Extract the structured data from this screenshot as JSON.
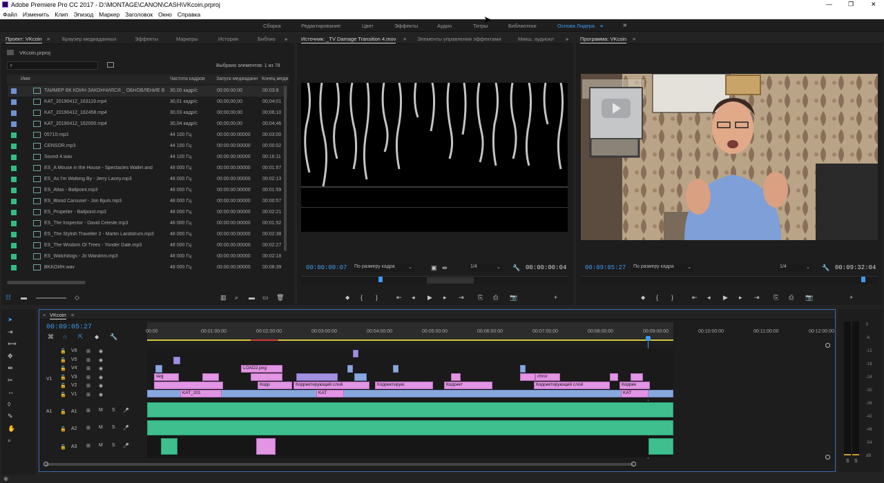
{
  "window": {
    "title": "Adobe Premiere Pro CC 2017 - D:\\MONTAGE\\CANON\\CASH\\VKcoin.prproj",
    "controls": [
      "—",
      "❐",
      "✕"
    ]
  },
  "menu": [
    "Файл",
    "Изменить",
    "Клип",
    "Эпизод",
    "Маркер",
    "Заголовок",
    "Окно",
    "Справка"
  ],
  "workspaces": [
    "Сборка",
    "Редактирование",
    "Цвет",
    "Эффекты",
    "Аудио",
    "Титры",
    "Библиотеки",
    "Основа Лидера"
  ],
  "workspace_active": "Основа Лидера",
  "workspace_more": "»",
  "project": {
    "tabs": [
      "Проект: VKcoin",
      "Браузер медиаданных",
      "Эффекты",
      "Маркеры",
      "История",
      "Библио"
    ],
    "file": "VKcoin.prproj",
    "selection": "Выбрано элементов: 1 из 78",
    "headers": [
      "Имя",
      "Частота кадров",
      "Запуск медиаданн",
      "Конец меди"
    ],
    "rows": [
      {
        "name": "ТАЙМЕР ВК КОИН ЗАКОНЧИЛСЯ _ ОБНОВЛЕНИЕ В",
        "fps": "30,00 кадр/с",
        "start": "00:00:00:00",
        "end": "00:03:8",
        "color": "#6d93d4",
        "type": "video"
      },
      {
        "name": "KAT_20190412_163119.mp4",
        "fps": "30,01 кадр/с",
        "start": "00;00;00;00",
        "end": "00;04;01",
        "color": "#6d93d4",
        "type": "video"
      },
      {
        "name": "KAT_20190412_162458.mp4",
        "fps": "30,03 кадр/с",
        "start": "00;00;00;00",
        "end": "00;06;10",
        "color": "#6d93d4",
        "type": "video"
      },
      {
        "name": "KAT_20190412_162000.mp4",
        "fps": "30,04 кадр/с",
        "start": "00;00;00;00",
        "end": "00;04;46",
        "color": "#6d93d4",
        "type": "video"
      },
      {
        "name": "05710.mp3",
        "fps": "44 100 Гц",
        "start": "00:00:00:00000",
        "end": "00:03:00",
        "color": "#2fbf83",
        "type": "audio"
      },
      {
        "name": "CENSOR.mp3",
        "fps": "44 100 Гц",
        "start": "00:00:00:00000",
        "end": "00:00:02",
        "color": "#2fbf83",
        "type": "audio"
      },
      {
        "name": "Sound 4.wav",
        "fps": "44 100 Гц",
        "start": "00:00:00:00000",
        "end": "00:16:11",
        "color": "#2fbf83",
        "type": "audio"
      },
      {
        "name": "ES_A Mouse in the House - Spectacles Wallet and",
        "fps": "48 000 Гц",
        "start": "00:00:00:00000",
        "end": "00:01:57",
        "color": "#2fbf83",
        "type": "audio"
      },
      {
        "name": "ES_As I'm Walking By - Jerry Lacey.mp3",
        "fps": "48 000 Гц",
        "start": "00:00:00:00000",
        "end": "00:02:13",
        "color": "#2fbf83",
        "type": "audio"
      },
      {
        "name": "ES_Atlas - Ballpoint.mp3",
        "fps": "48 000 Гц",
        "start": "00:00:00:00000",
        "end": "00:01:59",
        "color": "#2fbf83",
        "type": "audio"
      },
      {
        "name": "ES_Blood Carousel - Jon Bjurk.mp3",
        "fps": "48 000 Гц",
        "start": "00:00:00:00000",
        "end": "00:00:57",
        "color": "#2fbf83",
        "type": "audio"
      },
      {
        "name": "ES_Propeller - Ballpoint.mp3",
        "fps": "48 000 Гц",
        "start": "00:00:00:00000",
        "end": "00:02:21",
        "color": "#2fbf83",
        "type": "audio"
      },
      {
        "name": "ES_The Inspector - David Celeste.mp3",
        "fps": "48 000 Гц",
        "start": "00:00:00:00000",
        "end": "00:01:52",
        "color": "#2fbf83",
        "type": "audio"
      },
      {
        "name": "ES_The Stylish Traveller 2 - Martin Landstrum.mp3",
        "fps": "48 000 Гц",
        "start": "00:00:00:00000",
        "end": "00:02:38",
        "color": "#2fbf83",
        "type": "audio"
      },
      {
        "name": "ES_The Wisdom Of Trees - Yonder Dale.mp3",
        "fps": "48 000 Гц",
        "start": "00:00:00:00000",
        "end": "00:02:27",
        "color": "#2fbf83",
        "type": "audio"
      },
      {
        "name": "ES_Watchdogs - Jo Wandrini.mp3",
        "fps": "48 000 Гц",
        "start": "00:00:00:00000",
        "end": "00:02:18",
        "color": "#2fbf83",
        "type": "audio"
      },
      {
        "name": "BKKOИH.wav",
        "fps": "48 000 Гц",
        "start": "00:00:00:00000",
        "end": "00:08:39",
        "color": "#2fbf83",
        "type": "audio"
      }
    ]
  },
  "source": {
    "tabs": [
      "Источник: _TV Damage Transition 4.mov",
      "Элементы управления эффектами",
      "Микш. аудиокл"
    ],
    "timecode": "00:00:00:07",
    "fit": "По размеру кадра",
    "quality": "1/4",
    "duration": "00:00:00:04"
  },
  "program": {
    "title": "Программа: VKcoin",
    "timecode": "00:09:05:27",
    "fit": "По размеру кадра",
    "quality": "1/4",
    "duration": "00:09:32:04"
  },
  "timeline": {
    "sequence": "VKcoin",
    "timecode": "00:09:05:27",
    "ruler": [
      "00:00",
      "00:01:00:00",
      "00:02:00:00",
      "00:03:00:00",
      "00:04:00:00",
      "00:05:00:00",
      "00:06:00:00",
      "00:07:00:00",
      "00:08:00:00",
      "00:09:00:00",
      "00:10:00:00",
      "00:11:00:00",
      "00:12:00:00"
    ],
    "video_tracks": [
      "V6",
      "V5",
      "V4",
      "V3",
      "V2",
      "V1"
    ],
    "audio_tracks": [
      "A1",
      "A2",
      "A3"
    ],
    "source_patch_v": "V1",
    "source_patch_a": "A1",
    "clip_labels": {
      "load": "LOAD2.png",
      "seg": "seg",
      "chrome": "chror",
      "adjust1": "Корректирующий слой",
      "adjust2": "Корректирую",
      "adjust3": "Коррект",
      "adjust4": "Корректирующий слой",
      "adjust5": "Коррек",
      "adjust6": "Корр",
      "kat1": "KAT_201",
      "kat2": "KAT",
      "kat3": "KAT"
    },
    "toggles": {
      "mute": "M",
      "solo": "S"
    }
  },
  "meter": {
    "scale": [
      "0",
      "-6",
      "-12",
      "-18",
      "-24",
      "-30",
      "-36",
      "-42",
      "-48",
      "-54",
      "dB"
    ],
    "solo": [
      "S",
      "S"
    ]
  },
  "colors": {
    "accent": "#3d9bf0",
    "video_clip": "#e294e5",
    "audio_clip": "#3fbf8d",
    "playhead": "#3d9bf0"
  }
}
